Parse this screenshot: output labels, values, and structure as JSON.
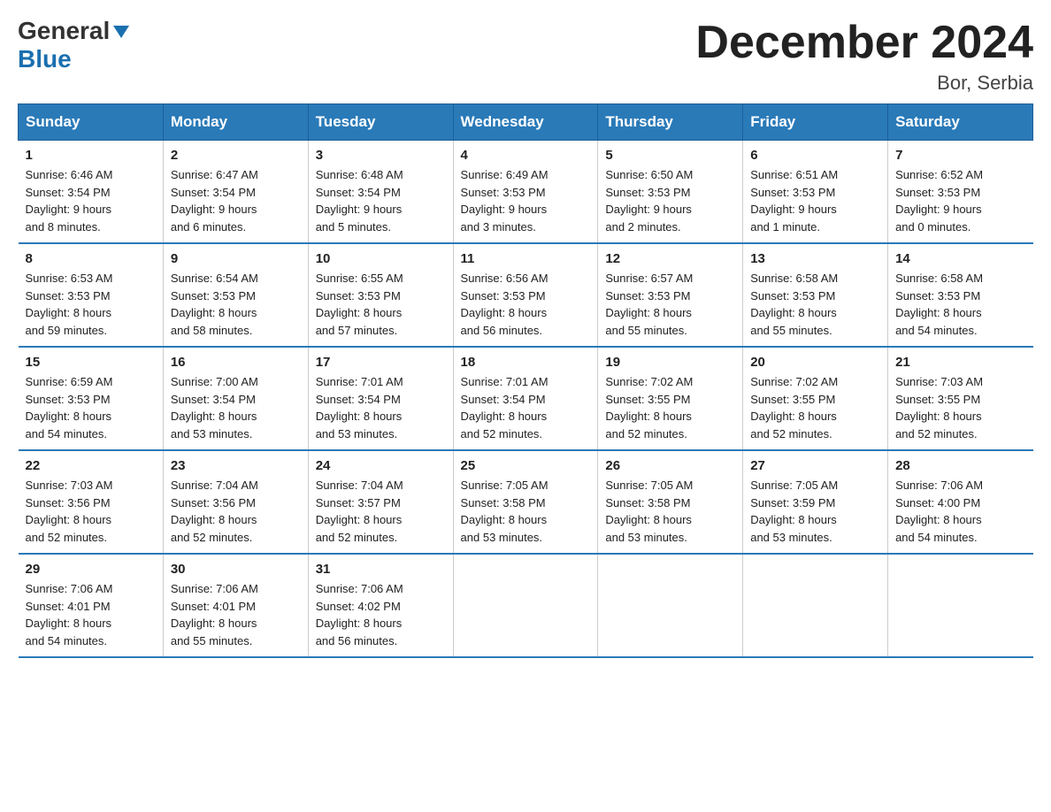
{
  "logo": {
    "general": "General",
    "blue": "Blue"
  },
  "title": {
    "month_year": "December 2024",
    "location": "Bor, Serbia"
  },
  "calendar": {
    "headers": [
      "Sunday",
      "Monday",
      "Tuesday",
      "Wednesday",
      "Thursday",
      "Friday",
      "Saturday"
    ],
    "weeks": [
      [
        {
          "day": "1",
          "info": "Sunrise: 6:46 AM\nSunset: 3:54 PM\nDaylight: 9 hours\nand 8 minutes."
        },
        {
          "day": "2",
          "info": "Sunrise: 6:47 AM\nSunset: 3:54 PM\nDaylight: 9 hours\nand 6 minutes."
        },
        {
          "day": "3",
          "info": "Sunrise: 6:48 AM\nSunset: 3:54 PM\nDaylight: 9 hours\nand 5 minutes."
        },
        {
          "day": "4",
          "info": "Sunrise: 6:49 AM\nSunset: 3:53 PM\nDaylight: 9 hours\nand 3 minutes."
        },
        {
          "day": "5",
          "info": "Sunrise: 6:50 AM\nSunset: 3:53 PM\nDaylight: 9 hours\nand 2 minutes."
        },
        {
          "day": "6",
          "info": "Sunrise: 6:51 AM\nSunset: 3:53 PM\nDaylight: 9 hours\nand 1 minute."
        },
        {
          "day": "7",
          "info": "Sunrise: 6:52 AM\nSunset: 3:53 PM\nDaylight: 9 hours\nand 0 minutes."
        }
      ],
      [
        {
          "day": "8",
          "info": "Sunrise: 6:53 AM\nSunset: 3:53 PM\nDaylight: 8 hours\nand 59 minutes."
        },
        {
          "day": "9",
          "info": "Sunrise: 6:54 AM\nSunset: 3:53 PM\nDaylight: 8 hours\nand 58 minutes."
        },
        {
          "day": "10",
          "info": "Sunrise: 6:55 AM\nSunset: 3:53 PM\nDaylight: 8 hours\nand 57 minutes."
        },
        {
          "day": "11",
          "info": "Sunrise: 6:56 AM\nSunset: 3:53 PM\nDaylight: 8 hours\nand 56 minutes."
        },
        {
          "day": "12",
          "info": "Sunrise: 6:57 AM\nSunset: 3:53 PM\nDaylight: 8 hours\nand 55 minutes."
        },
        {
          "day": "13",
          "info": "Sunrise: 6:58 AM\nSunset: 3:53 PM\nDaylight: 8 hours\nand 55 minutes."
        },
        {
          "day": "14",
          "info": "Sunrise: 6:58 AM\nSunset: 3:53 PM\nDaylight: 8 hours\nand 54 minutes."
        }
      ],
      [
        {
          "day": "15",
          "info": "Sunrise: 6:59 AM\nSunset: 3:53 PM\nDaylight: 8 hours\nand 54 minutes."
        },
        {
          "day": "16",
          "info": "Sunrise: 7:00 AM\nSunset: 3:54 PM\nDaylight: 8 hours\nand 53 minutes."
        },
        {
          "day": "17",
          "info": "Sunrise: 7:01 AM\nSunset: 3:54 PM\nDaylight: 8 hours\nand 53 minutes."
        },
        {
          "day": "18",
          "info": "Sunrise: 7:01 AM\nSunset: 3:54 PM\nDaylight: 8 hours\nand 52 minutes."
        },
        {
          "day": "19",
          "info": "Sunrise: 7:02 AM\nSunset: 3:55 PM\nDaylight: 8 hours\nand 52 minutes."
        },
        {
          "day": "20",
          "info": "Sunrise: 7:02 AM\nSunset: 3:55 PM\nDaylight: 8 hours\nand 52 minutes."
        },
        {
          "day": "21",
          "info": "Sunrise: 7:03 AM\nSunset: 3:55 PM\nDaylight: 8 hours\nand 52 minutes."
        }
      ],
      [
        {
          "day": "22",
          "info": "Sunrise: 7:03 AM\nSunset: 3:56 PM\nDaylight: 8 hours\nand 52 minutes."
        },
        {
          "day": "23",
          "info": "Sunrise: 7:04 AM\nSunset: 3:56 PM\nDaylight: 8 hours\nand 52 minutes."
        },
        {
          "day": "24",
          "info": "Sunrise: 7:04 AM\nSunset: 3:57 PM\nDaylight: 8 hours\nand 52 minutes."
        },
        {
          "day": "25",
          "info": "Sunrise: 7:05 AM\nSunset: 3:58 PM\nDaylight: 8 hours\nand 53 minutes."
        },
        {
          "day": "26",
          "info": "Sunrise: 7:05 AM\nSunset: 3:58 PM\nDaylight: 8 hours\nand 53 minutes."
        },
        {
          "day": "27",
          "info": "Sunrise: 7:05 AM\nSunset: 3:59 PM\nDaylight: 8 hours\nand 53 minutes."
        },
        {
          "day": "28",
          "info": "Sunrise: 7:06 AM\nSunset: 4:00 PM\nDaylight: 8 hours\nand 54 minutes."
        }
      ],
      [
        {
          "day": "29",
          "info": "Sunrise: 7:06 AM\nSunset: 4:01 PM\nDaylight: 8 hours\nand 54 minutes."
        },
        {
          "day": "30",
          "info": "Sunrise: 7:06 AM\nSunset: 4:01 PM\nDaylight: 8 hours\nand 55 minutes."
        },
        {
          "day": "31",
          "info": "Sunrise: 7:06 AM\nSunset: 4:02 PM\nDaylight: 8 hours\nand 56 minutes."
        },
        null,
        null,
        null,
        null
      ]
    ]
  }
}
